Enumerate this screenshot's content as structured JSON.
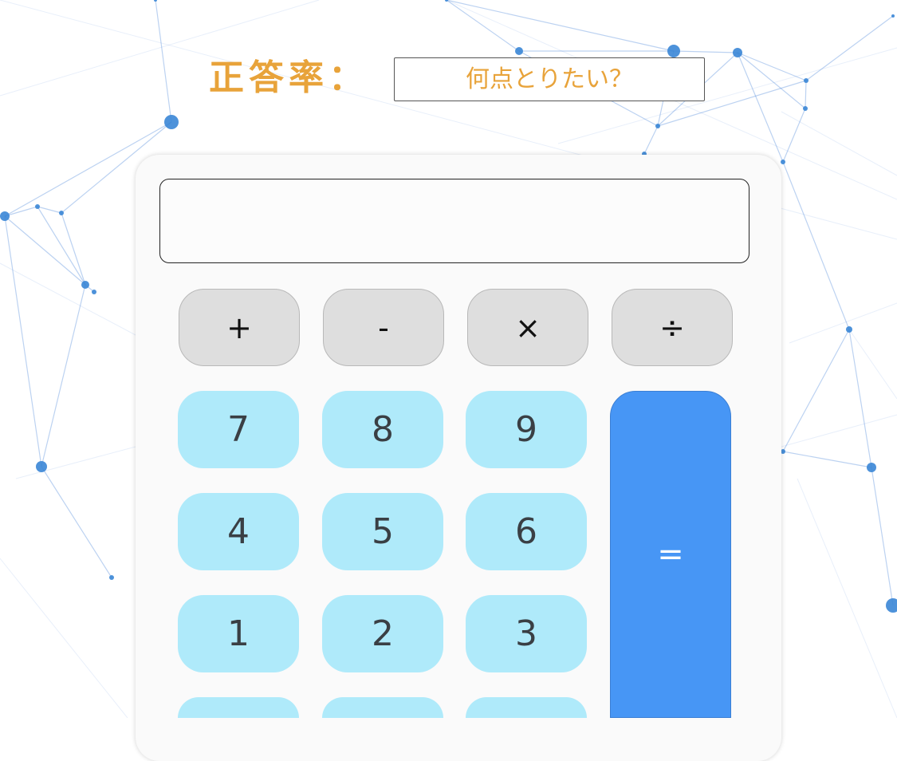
{
  "header": {
    "title": "正答率：",
    "target_input": {
      "placeholder": "何点とりたい？",
      "value": ""
    }
  },
  "calculator": {
    "display_value": "",
    "operators": [
      {
        "label": "+",
        "name": "add"
      },
      {
        "label": "-",
        "name": "subtract"
      },
      {
        "label": "×",
        "name": "multiply"
      },
      {
        "label": "÷",
        "name": "divide"
      }
    ],
    "digits": {
      "seven": "7",
      "eight": "8",
      "nine": "9",
      "four": "4",
      "five": "5",
      "six": "6",
      "one": "1",
      "two": "2",
      "three": "3"
    },
    "equals_label": "="
  },
  "colors": {
    "title_accent": "#e8a33a",
    "operator_bg": "#dedede",
    "digit_bg": "#afeafa",
    "equals_bg": "#4796f5",
    "network_line": "#3f7ed8"
  }
}
